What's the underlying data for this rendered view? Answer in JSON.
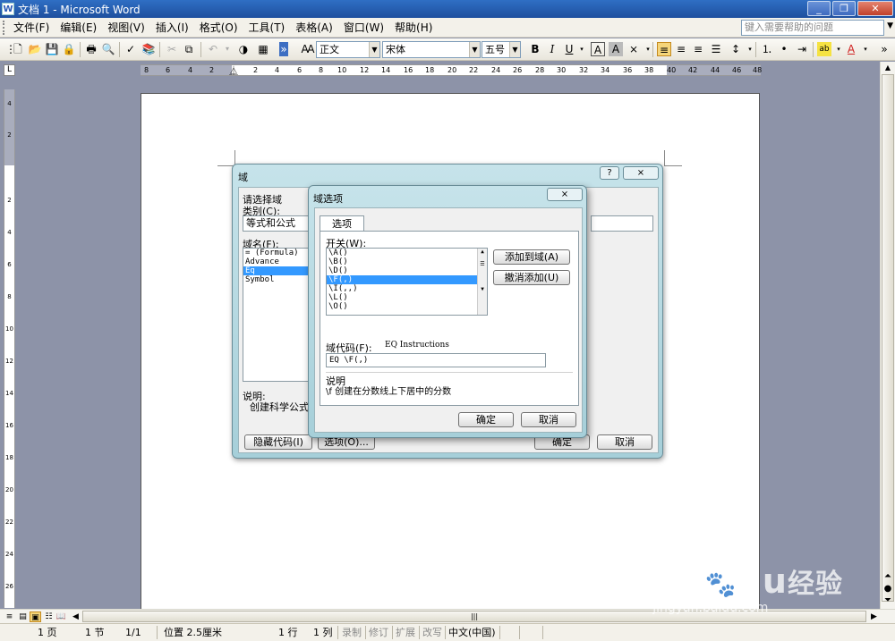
{
  "window": {
    "title": "文档 1 - Microsoft Word",
    "app_icon": "word-doc-icon",
    "buttons": [
      "minimize",
      "restore",
      "close"
    ]
  },
  "menubar": {
    "items": [
      "文件(F)",
      "编辑(E)",
      "视图(V)",
      "插入(I)",
      "格式(O)",
      "工具(T)",
      "表格(A)",
      "窗口(W)",
      "帮助(H)"
    ],
    "help_placeholder": "键入需要帮助的问题"
  },
  "toolbar": {
    "style": "正文",
    "font": "宋体",
    "size": "五号",
    "bold": "B",
    "italic": "I",
    "underline": "U",
    "char_border": "A",
    "char_shade": "A",
    "paste_icon": "⨯",
    "highlight": "ab",
    "font_color": "A"
  },
  "ruler": {
    "horizontal_ticks": [
      "8",
      "6",
      "4",
      "2",
      "",
      "2",
      "4",
      "6",
      "8",
      "10",
      "12",
      "14",
      "16",
      "18",
      "20",
      "22",
      "24",
      "26",
      "28",
      "30",
      "32",
      "34",
      "36",
      "38",
      "40",
      "42",
      "44",
      "46",
      "48"
    ],
    "vertical_ticks": [
      "4",
      "2",
      "",
      "2",
      "4",
      "6",
      "8",
      "10",
      "12",
      "14",
      "16",
      "18",
      "20",
      "22",
      "24",
      "26"
    ]
  },
  "field_dialog": {
    "title": "域",
    "help_label": "?",
    "close_label": "⨯",
    "choose_label": "请选择域",
    "category_label": "类别(C):",
    "category_value": "等式和公式",
    "fieldname_label": "域名(F):",
    "field_names": [
      "= (Formula)",
      "Advance",
      "Eq",
      "Symbol"
    ],
    "selected_field": "Eq",
    "desc_label": "说明:",
    "desc_value": "创建科学公式",
    "hide_codes_btn": "隐藏代码(I)",
    "options_btn": "选项(O)...",
    "ok_btn": "确定",
    "cancel_btn": "取消"
  },
  "options_dialog": {
    "title": "域选项",
    "close_label": "⨯",
    "tab_label": "选项",
    "switches_label": "开关(W):",
    "switches": [
      "\\A()",
      "\\B()",
      "\\D()",
      "\\F(,)",
      "\\I(,,)",
      "\\L()",
      "\\O()"
    ],
    "selected_switch": "\\F(,)",
    "add_btn": "添加到域(A)",
    "undo_btn": "撤消添加(U)",
    "code_label": "域代码(F):",
    "code_hint": "EQ Instructions",
    "code_value": "EQ \\F(,)",
    "desc_label": "说明",
    "desc_value": "\\f 创建在分数线上下居中的分数",
    "ok_btn": "确定",
    "cancel_btn": "取消"
  },
  "statusbar": {
    "page": "1 页",
    "section": "1 节",
    "page_of": "1/1",
    "position": "位置 2.5厘米",
    "line": "1 行",
    "column": "1 列",
    "rec": "录制",
    "trk": "修订",
    "ext": "扩展",
    "ovr": "改写",
    "lang": "中文(中国)"
  },
  "watermark": {
    "logo_a": "Bai",
    "logo_b": "du",
    "logo_cn": "经验",
    "url": "jingyan.baidu.com"
  }
}
